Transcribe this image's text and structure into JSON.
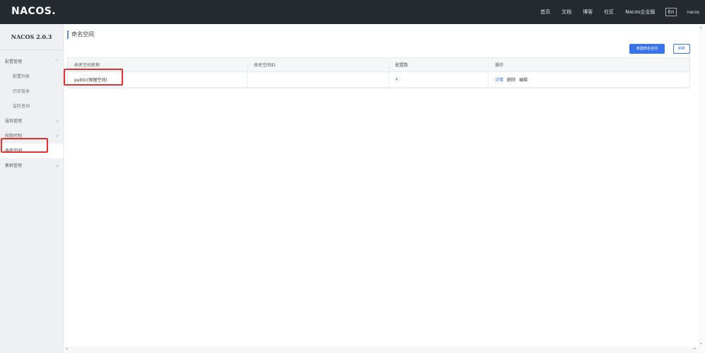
{
  "header": {
    "logo": "NACOS.",
    "nav": [
      "首页",
      "文档",
      "博客",
      "社区",
      "Nacos企业版"
    ],
    "lang": "En",
    "user": "nacos"
  },
  "sidebar": {
    "version": "NACOS 2.0.3",
    "config_group": {
      "label": "配置管理",
      "items": [
        "配置列表",
        "历史版本",
        "监听查询"
      ]
    },
    "service_group": {
      "label": "服务管理"
    },
    "auth_group": {
      "label": "权限控制"
    },
    "namespace": {
      "label": "命名空间"
    },
    "cluster_group": {
      "label": "集群管理"
    }
  },
  "main": {
    "title": "命名空间",
    "create_button": "新建命名空间",
    "refresh_button": "刷新",
    "table": {
      "headers": [
        "命名空间名称",
        "命名空间ID",
        "配置数",
        "操作"
      ],
      "rows": [
        {
          "name": "public(保留空间)",
          "id": "",
          "count": "4",
          "ops": [
            "详情",
            "删除",
            "编辑"
          ]
        }
      ]
    }
  },
  "colors": {
    "topbar": "#252a2f",
    "sidebar": "#eef0f3",
    "primary": "#3a73e8",
    "highlight": "#e8302f"
  }
}
